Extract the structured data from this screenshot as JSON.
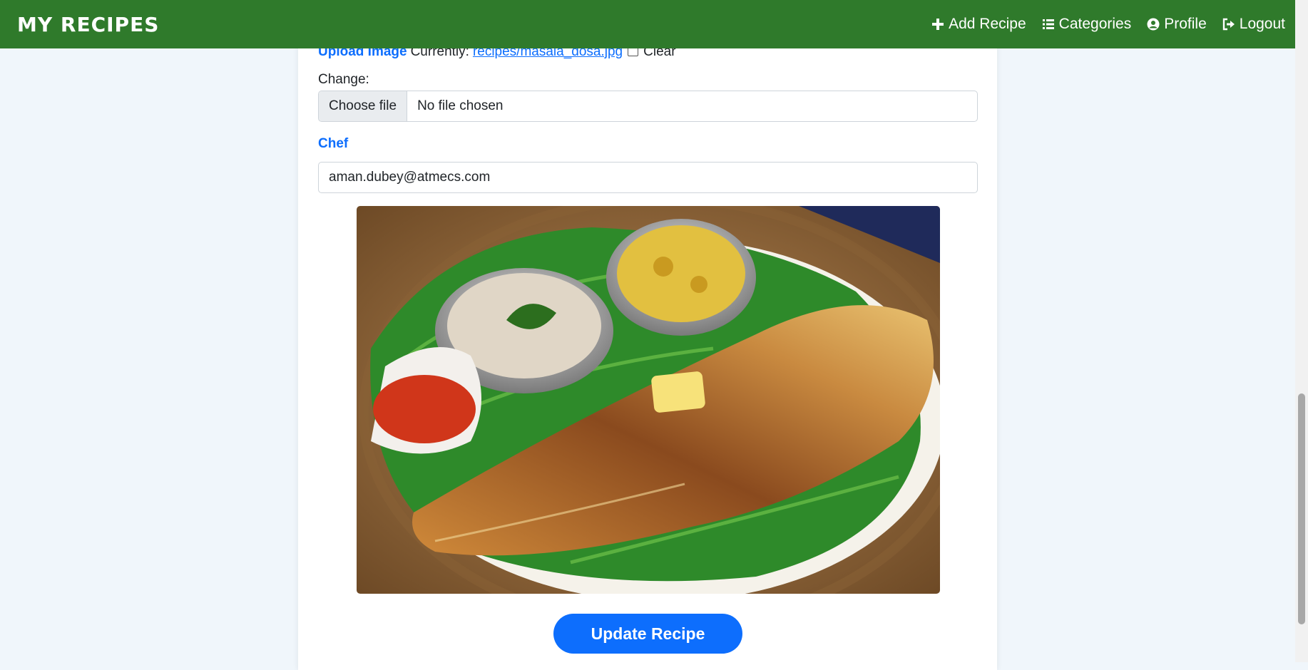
{
  "navbar": {
    "brand": "MY RECIPES",
    "links": [
      {
        "label": "Add Recipe",
        "icon": "plus-icon"
      },
      {
        "label": "Categories",
        "icon": "list-icon"
      },
      {
        "label": "Profile",
        "icon": "user-circle-icon"
      },
      {
        "label": "Logout",
        "icon": "logout-icon"
      }
    ]
  },
  "form": {
    "upload_image": {
      "label": "Upload Image",
      "currently_text": "Currently:",
      "current_file": "recipes/masala_dosa.jpg",
      "clear_label": "Clear",
      "change_label": "Change:",
      "choose_button": "Choose file",
      "file_status": "No file chosen"
    },
    "chef": {
      "label": "Chef",
      "value": "aman.dubey@atmecs.com"
    },
    "submit_label": "Update Recipe"
  },
  "colors": {
    "navbar": "#2f7a2b",
    "accent": "#0d6efd",
    "background": "#f0f6fb"
  }
}
